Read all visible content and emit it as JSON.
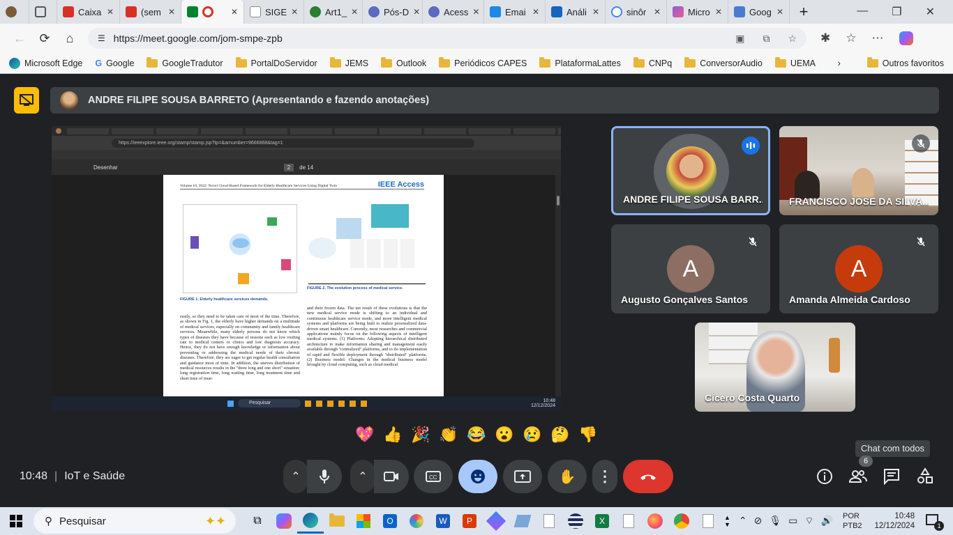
{
  "browser": {
    "tabs": [
      {
        "label": "",
        "color": "#7a5c3b"
      },
      {
        "label": "",
        "color": "#555"
      },
      {
        "label": "Caixa",
        "color": "#d93025"
      },
      {
        "label": "(sem",
        "color": "#d93025"
      },
      {
        "label": "",
        "color": "#00832d",
        "active": true
      },
      {
        "label": "SIGE",
        "color": "#888"
      },
      {
        "label": "Art1_",
        "color": "#2e7d32"
      },
      {
        "label": "Pós-D",
        "color": "#5c6bc0"
      },
      {
        "label": "Acess",
        "color": "#5c6bc0"
      },
      {
        "label": "Emai",
        "color": "#1e88e5"
      },
      {
        "label": "Análi",
        "color": "#1565c0"
      },
      {
        "label": "sinôr",
        "color": "#4285f4"
      },
      {
        "label": "Micro",
        "color": "#8e5bd8"
      },
      {
        "label": "Goog",
        "color": "#4a7bd0"
      }
    ],
    "url": "https://meet.google.com/jom-smpe-zpb",
    "bookmarks": [
      {
        "label": "Microsoft Edge",
        "icon": "edge-icon"
      },
      {
        "label": "Google",
        "icon": "google-icon"
      },
      {
        "label": "GoogleTradutor",
        "icon": "folder-icon"
      },
      {
        "label": "PortalDoServidor",
        "icon": "folder-icon"
      },
      {
        "label": "JEMS",
        "icon": "folder-icon"
      },
      {
        "label": "Outlook",
        "icon": "folder-icon"
      },
      {
        "label": "Periódicos CAPES",
        "icon": "folder-icon"
      },
      {
        "label": "PlataformaLattes",
        "icon": "folder-icon"
      },
      {
        "label": "CNPq",
        "icon": "folder-icon"
      },
      {
        "label": "ConversorAudio",
        "icon": "folder-icon"
      },
      {
        "label": "UEMA",
        "icon": "folder-icon"
      }
    ],
    "other_favorites": "Outros favoritos"
  },
  "meet": {
    "presenter_label": "ANDRE FILIPE SOUSA BARRETO (Apresentando e fazendo anotações)",
    "shared_screen": {
      "url": "https://ieeexplore.ieee.org/stamp/stamp.jsp?tp=&arnumber=9666868&tag=1",
      "toolbar_draw": "Desenhar",
      "page": "2",
      "page_total": "de 14",
      "paper_header": "Volume 10, 2022: Novel Cloud-Based Framework for Elderly Healthcare Services Using Digital Twin",
      "journal": "IEEE Access",
      "fig1_caption": "FIGURE 1. Elderly healthcare services demands.",
      "fig2_caption": "FIGURE 2. The evolution process of medical service.",
      "col1_text": "easily, so they need to be taken care of most of the time. Therefore, as shown in Fig. 1, the elderly have higher demands on a multitude of medical services, especially on community and family healthcare services. Meanwhile, many elderly persons do not know which types of diseases they have because of reasons such as low visiting rate to medical centers or clinics and low diagnosis accuracy. Hence, they do not have enough knowledge or information about preventing or addressing the medical needs of their chronic diseases. Therefore, they are eager to get regular health consultation and guidance most of time. In addition, the uneven distribution of medical resources results in the \"three long and one short\" situation: long registration time, long waiting time, long treatment time and short time of treat-",
      "col2_text": "and their frozen data. The net result of these evolutions is that the new medical service mode is shifting to an individual and continuous healthcare service mode, and more intelligent medical systems and platforms are being built to realize personalized data-driven smart healthcare. Currently, most researches and commercial applications mainly focus on the following aspects of intelligent medical systems. (1) Platforms: Adopting hierarchical distributed architecture to make information sharing and management easily available through \"centralized\" platforms, and to do implementation of rapid and flexible deployment through \"distributed\" platforms. (2) Business model: Changes in the medical business model brought by cloud computing, such as cloud medical",
      "search_label": "Pesquisar",
      "time": "10:48",
      "date": "12/12/2024"
    },
    "participants": [
      {
        "name": "ANDRE FILIPE SOUSA BARR...",
        "speaking": true
      },
      {
        "name": "FRANCISCO JOSE DA SILVA...",
        "muted": true
      },
      {
        "name": "Augusto Gonçalves Santos",
        "initial": "A",
        "color": "#8d6e63",
        "muted": true
      },
      {
        "name": "Amanda Almeida Cardoso",
        "initial": "A",
        "color": "#c53b0c",
        "muted": true
      },
      {
        "name": "Cícero Costa Quarto"
      }
    ],
    "reactions": [
      "💖",
      "👍",
      "🎉",
      "👏",
      "😂",
      "😮",
      "😢",
      "🤔",
      "👎"
    ],
    "time": "10:48",
    "meeting_title": "IoT e Saúde",
    "chat_tooltip": "Chat com todos",
    "people_count": "6"
  },
  "taskbar": {
    "search_placeholder": "Pesquisar",
    "lang1": "POR",
    "lang2": "PTB2",
    "time": "10:48",
    "date": "12/12/2024",
    "notifications": "1"
  }
}
